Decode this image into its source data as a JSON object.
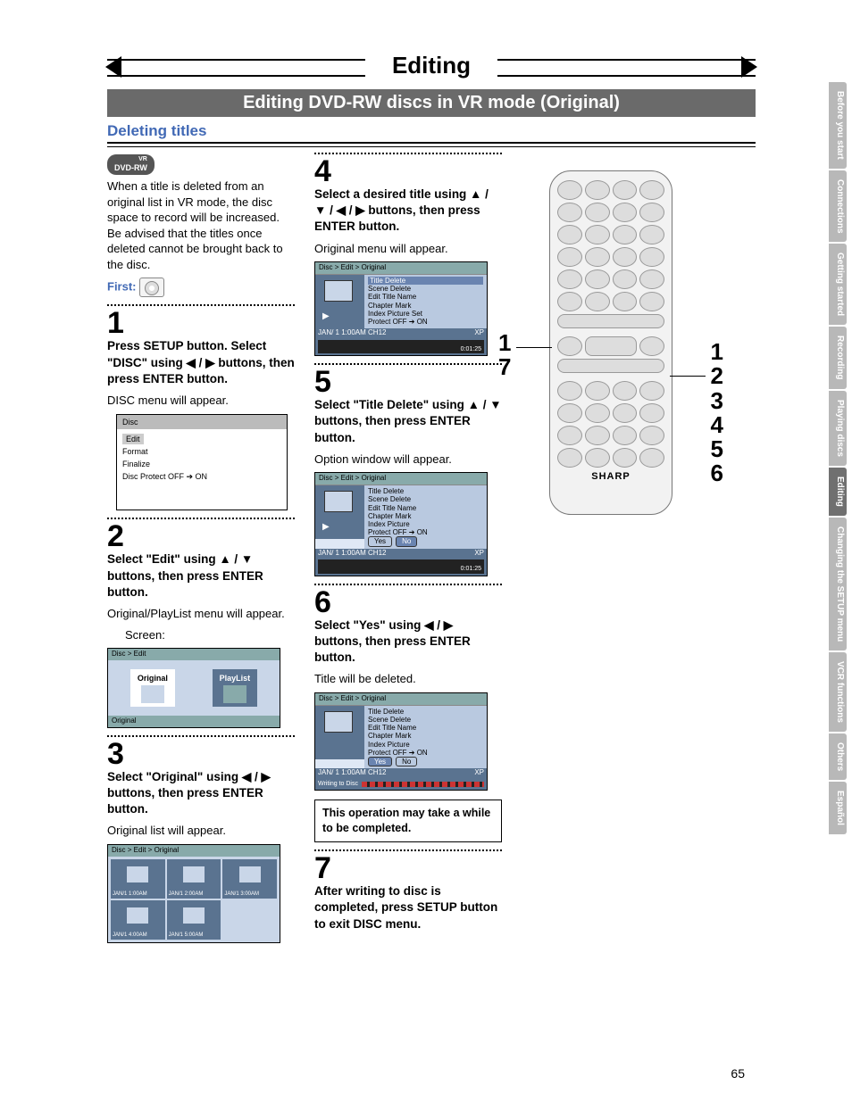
{
  "page_number": "65",
  "top_title": "Editing",
  "section_bar": "Editing DVD-RW discs in VR mode (Original)",
  "subhead": "Deleting titles",
  "badge": "DVD-RW",
  "badge_vr": "VR",
  "intro": "When a title is deleted from an original list in VR mode, the disc space to record will be increased. Be advised that the titles once deleted cannot be brought back to the disc.",
  "first_label": "First:",
  "steps": {
    "s1": {
      "num": "1",
      "bold": "Press SETUP button. Select \"DISC\" using ◀ / ▶ buttons, then press ENTER button.",
      "note": "DISC menu will appear."
    },
    "s2": {
      "num": "2",
      "bold": "Select \"Edit\" using ▲ / ▼ buttons, then press ENTER button.",
      "note": "Original/PlayList menu will appear.",
      "sub": "Screen:"
    },
    "s3": {
      "num": "3",
      "bold": "Select \"Original\" using ◀ / ▶ buttons, then press ENTER button.",
      "note": "Original list will appear."
    },
    "s4": {
      "num": "4",
      "bold": "Select a desired title using ▲ / ▼ / ◀ / ▶ buttons, then press ENTER button.",
      "note": "Original menu will appear."
    },
    "s5": {
      "num": "5",
      "bold": "Select \"Title Delete\" using ▲ / ▼ buttons, then press ENTER button.",
      "note": "Option window will appear."
    },
    "s6": {
      "num": "6",
      "bold": "Select \"Yes\" using ◀ / ▶ buttons, then press ENTER button.",
      "note": "Title will be deleted."
    },
    "s7": {
      "num": "7",
      "bold": "After writing to disc is completed, press SETUP button to exit DISC menu."
    }
  },
  "caution": "This operation may take a while to be completed.",
  "osd_disc": {
    "title": "Disc",
    "items": [
      "Edit",
      "Format",
      "Finalize",
      "Disc Protect OFF ➔ ON"
    ]
  },
  "osd_edit": {
    "crumb": "Disc > Edit",
    "original": "Original",
    "playlist": "PlayList",
    "footer": "Original"
  },
  "osd_titlelist": {
    "crumb": "Disc > Edit > Original",
    "cells": [
      "JAN/1  1:00AM",
      "JAN/1  2:00AM",
      "JAN/1  3:00AM",
      "JAN/1  4:00AM",
      "JAN/1  5:00AM",
      ""
    ]
  },
  "osd_menu": {
    "crumb": "Disc > Edit > Original",
    "items": [
      "Title Delete",
      "Scene Delete",
      "Edit Title Name",
      "Chapter Mark",
      "Index Picture Set",
      "Protect OFF ➔ ON"
    ],
    "status_left": "JAN/ 1   1:00AM  CH12",
    "status_right": "XP",
    "time": "0:01:25"
  },
  "osd_confirm": {
    "crumb": "Disc > Edit > Original",
    "items": [
      "Title Delete",
      "Scene Delete",
      "Edit Title Name",
      "Chapter Mark",
      "Index Picture",
      "Protect OFF ➔ ON"
    ],
    "yes": "Yes",
    "no": "No",
    "status_left": "JAN/ 1   1:00AM  CH12",
    "status_right": "XP",
    "time": "0:01:25"
  },
  "osd_writing": {
    "crumb": "Disc > Edit > Original",
    "items": [
      "Title Delete",
      "Scene Delete",
      "Edit Title Name",
      "Chapter Mark",
      "Index Picture",
      "Protect OFF ➔ ON"
    ],
    "yes": "Yes",
    "no": "No",
    "status_left": "JAN/ 1   1:00AM  CH12",
    "status_right": "XP",
    "writing": "Writing to Disc"
  },
  "remote_callout_left": {
    "a": "1",
    "b": "7"
  },
  "remote_callout_right": [
    "1",
    "2",
    "3",
    "4",
    "5",
    "6"
  ],
  "remote_brand": "SHARP",
  "tabs": [
    {
      "label": "Before you start",
      "active": false
    },
    {
      "label": "Connections",
      "active": false
    },
    {
      "label": "Getting started",
      "active": false
    },
    {
      "label": "Recording",
      "active": false
    },
    {
      "label": "Playing discs",
      "active": false
    },
    {
      "label": "Editing",
      "active": true
    },
    {
      "label": "Changing the SETUP menu",
      "active": false
    },
    {
      "label": "VCR functions",
      "active": false
    },
    {
      "label": "Others",
      "active": false
    },
    {
      "label": "Español",
      "active": false
    }
  ]
}
